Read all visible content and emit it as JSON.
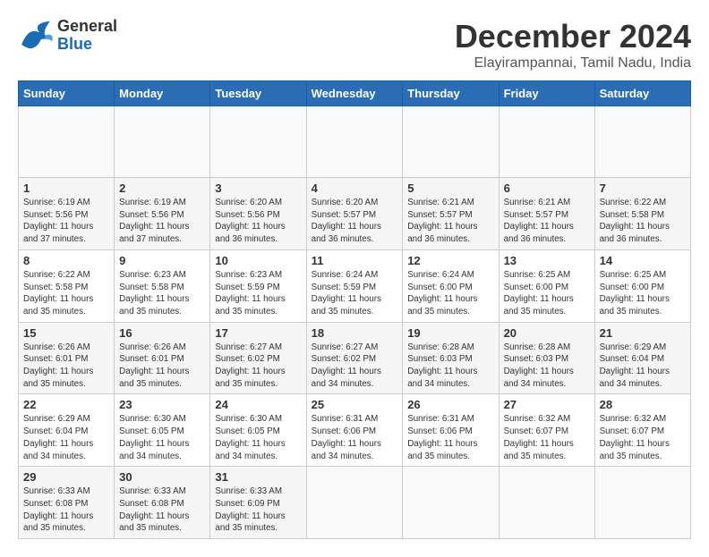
{
  "header": {
    "logo_general": "General",
    "logo_blue": "Blue",
    "month_title": "December 2024",
    "location": "Elayirampannai, Tamil Nadu, India"
  },
  "calendar": {
    "days_of_week": [
      "Sunday",
      "Monday",
      "Tuesday",
      "Wednesday",
      "Thursday",
      "Friday",
      "Saturday"
    ],
    "weeks": [
      [
        {
          "day": "",
          "info": ""
        },
        {
          "day": "",
          "info": ""
        },
        {
          "day": "",
          "info": ""
        },
        {
          "day": "",
          "info": ""
        },
        {
          "day": "",
          "info": ""
        },
        {
          "day": "",
          "info": ""
        },
        {
          "day": "",
          "info": ""
        }
      ],
      [
        {
          "day": "1",
          "info": "Sunrise: 6:19 AM\nSunset: 5:56 PM\nDaylight: 11 hours\nand 37 minutes."
        },
        {
          "day": "2",
          "info": "Sunrise: 6:19 AM\nSunset: 5:56 PM\nDaylight: 11 hours\nand 37 minutes."
        },
        {
          "day": "3",
          "info": "Sunrise: 6:20 AM\nSunset: 5:56 PM\nDaylight: 11 hours\nand 36 minutes."
        },
        {
          "day": "4",
          "info": "Sunrise: 6:20 AM\nSunset: 5:57 PM\nDaylight: 11 hours\nand 36 minutes."
        },
        {
          "day": "5",
          "info": "Sunrise: 6:21 AM\nSunset: 5:57 PM\nDaylight: 11 hours\nand 36 minutes."
        },
        {
          "day": "6",
          "info": "Sunrise: 6:21 AM\nSunset: 5:57 PM\nDaylight: 11 hours\nand 36 minutes."
        },
        {
          "day": "7",
          "info": "Sunrise: 6:22 AM\nSunset: 5:58 PM\nDaylight: 11 hours\nand 36 minutes."
        }
      ],
      [
        {
          "day": "8",
          "info": "Sunrise: 6:22 AM\nSunset: 5:58 PM\nDaylight: 11 hours\nand 35 minutes."
        },
        {
          "day": "9",
          "info": "Sunrise: 6:23 AM\nSunset: 5:58 PM\nDaylight: 11 hours\nand 35 minutes."
        },
        {
          "day": "10",
          "info": "Sunrise: 6:23 AM\nSunset: 5:59 PM\nDaylight: 11 hours\nand 35 minutes."
        },
        {
          "day": "11",
          "info": "Sunrise: 6:24 AM\nSunset: 5:59 PM\nDaylight: 11 hours\nand 35 minutes."
        },
        {
          "day": "12",
          "info": "Sunrise: 6:24 AM\nSunset: 6:00 PM\nDaylight: 11 hours\nand 35 minutes."
        },
        {
          "day": "13",
          "info": "Sunrise: 6:25 AM\nSunset: 6:00 PM\nDaylight: 11 hours\nand 35 minutes."
        },
        {
          "day": "14",
          "info": "Sunrise: 6:25 AM\nSunset: 6:00 PM\nDaylight: 11 hours\nand 35 minutes."
        }
      ],
      [
        {
          "day": "15",
          "info": "Sunrise: 6:26 AM\nSunset: 6:01 PM\nDaylight: 11 hours\nand 35 minutes."
        },
        {
          "day": "16",
          "info": "Sunrise: 6:26 AM\nSunset: 6:01 PM\nDaylight: 11 hours\nand 35 minutes."
        },
        {
          "day": "17",
          "info": "Sunrise: 6:27 AM\nSunset: 6:02 PM\nDaylight: 11 hours\nand 35 minutes."
        },
        {
          "day": "18",
          "info": "Sunrise: 6:27 AM\nSunset: 6:02 PM\nDaylight: 11 hours\nand 34 minutes."
        },
        {
          "day": "19",
          "info": "Sunrise: 6:28 AM\nSunset: 6:03 PM\nDaylight: 11 hours\nand 34 minutes."
        },
        {
          "day": "20",
          "info": "Sunrise: 6:28 AM\nSunset: 6:03 PM\nDaylight: 11 hours\nand 34 minutes."
        },
        {
          "day": "21",
          "info": "Sunrise: 6:29 AM\nSunset: 6:04 PM\nDaylight: 11 hours\nand 34 minutes."
        }
      ],
      [
        {
          "day": "22",
          "info": "Sunrise: 6:29 AM\nSunset: 6:04 PM\nDaylight: 11 hours\nand 34 minutes."
        },
        {
          "day": "23",
          "info": "Sunrise: 6:30 AM\nSunset: 6:05 PM\nDaylight: 11 hours\nand 34 minutes."
        },
        {
          "day": "24",
          "info": "Sunrise: 6:30 AM\nSunset: 6:05 PM\nDaylight: 11 hours\nand 34 minutes."
        },
        {
          "day": "25",
          "info": "Sunrise: 6:31 AM\nSunset: 6:06 PM\nDaylight: 11 hours\nand 34 minutes."
        },
        {
          "day": "26",
          "info": "Sunrise: 6:31 AM\nSunset: 6:06 PM\nDaylight: 11 hours\nand 35 minutes."
        },
        {
          "day": "27",
          "info": "Sunrise: 6:32 AM\nSunset: 6:07 PM\nDaylight: 11 hours\nand 35 minutes."
        },
        {
          "day": "28",
          "info": "Sunrise: 6:32 AM\nSunset: 6:07 PM\nDaylight: 11 hours\nand 35 minutes."
        }
      ],
      [
        {
          "day": "29",
          "info": "Sunrise: 6:33 AM\nSunset: 6:08 PM\nDaylight: 11 hours\nand 35 minutes."
        },
        {
          "day": "30",
          "info": "Sunrise: 6:33 AM\nSunset: 6:08 PM\nDaylight: 11 hours\nand 35 minutes."
        },
        {
          "day": "31",
          "info": "Sunrise: 6:33 AM\nSunset: 6:09 PM\nDaylight: 11 hours\nand 35 minutes."
        },
        {
          "day": "",
          "info": ""
        },
        {
          "day": "",
          "info": ""
        },
        {
          "day": "",
          "info": ""
        },
        {
          "day": "",
          "info": ""
        }
      ]
    ]
  }
}
